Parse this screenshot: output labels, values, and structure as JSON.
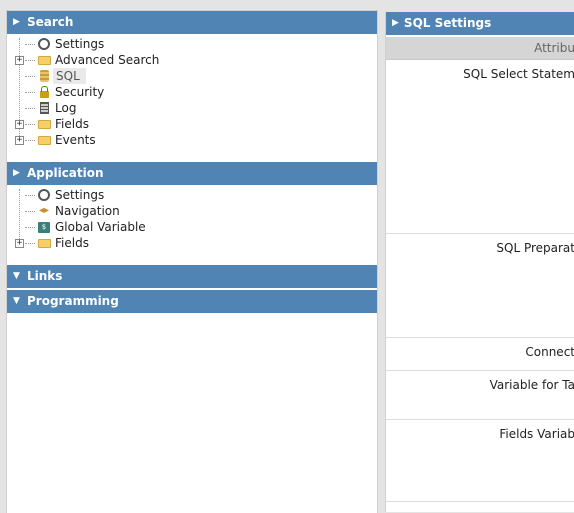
{
  "left": {
    "search": {
      "title": "Search",
      "items": [
        {
          "label": "Settings",
          "icon": "gear-icon"
        },
        {
          "label": "Advanced Search",
          "icon": "folder-icon",
          "expandable": true
        },
        {
          "label": "SQL",
          "icon": "database-icon",
          "selected": true
        },
        {
          "label": "Security",
          "icon": "lock-icon"
        },
        {
          "label": "Log",
          "icon": "log-icon"
        },
        {
          "label": "Fields",
          "icon": "folder-icon",
          "expandable": true
        },
        {
          "label": "Events",
          "icon": "folder-icon",
          "expandable": true
        }
      ]
    },
    "application": {
      "title": "Application",
      "items": [
        {
          "label": "Settings",
          "icon": "gear-icon"
        },
        {
          "label": "Navigation",
          "icon": "navigation-icon"
        },
        {
          "label": "Global Variable",
          "icon": "global-variable-icon",
          "icon_text": "$"
        },
        {
          "label": "Fields",
          "icon": "folder-icon",
          "expandable": true
        }
      ]
    },
    "links": {
      "title": "Links"
    },
    "programming": {
      "title": "Programming"
    }
  },
  "right": {
    "title": "SQL Settings",
    "attributes_header": "Attribu",
    "properties": [
      {
        "label": "SQL Select Statem"
      },
      {
        "label": "SQL Preparat"
      },
      {
        "label": "Connect"
      },
      {
        "label": "Variable for Ta"
      },
      {
        "label": "Fields Variab"
      }
    ]
  },
  "expand_symbol": "+",
  "collapsed_arrow": "▶",
  "expanded_arrow": "▼"
}
